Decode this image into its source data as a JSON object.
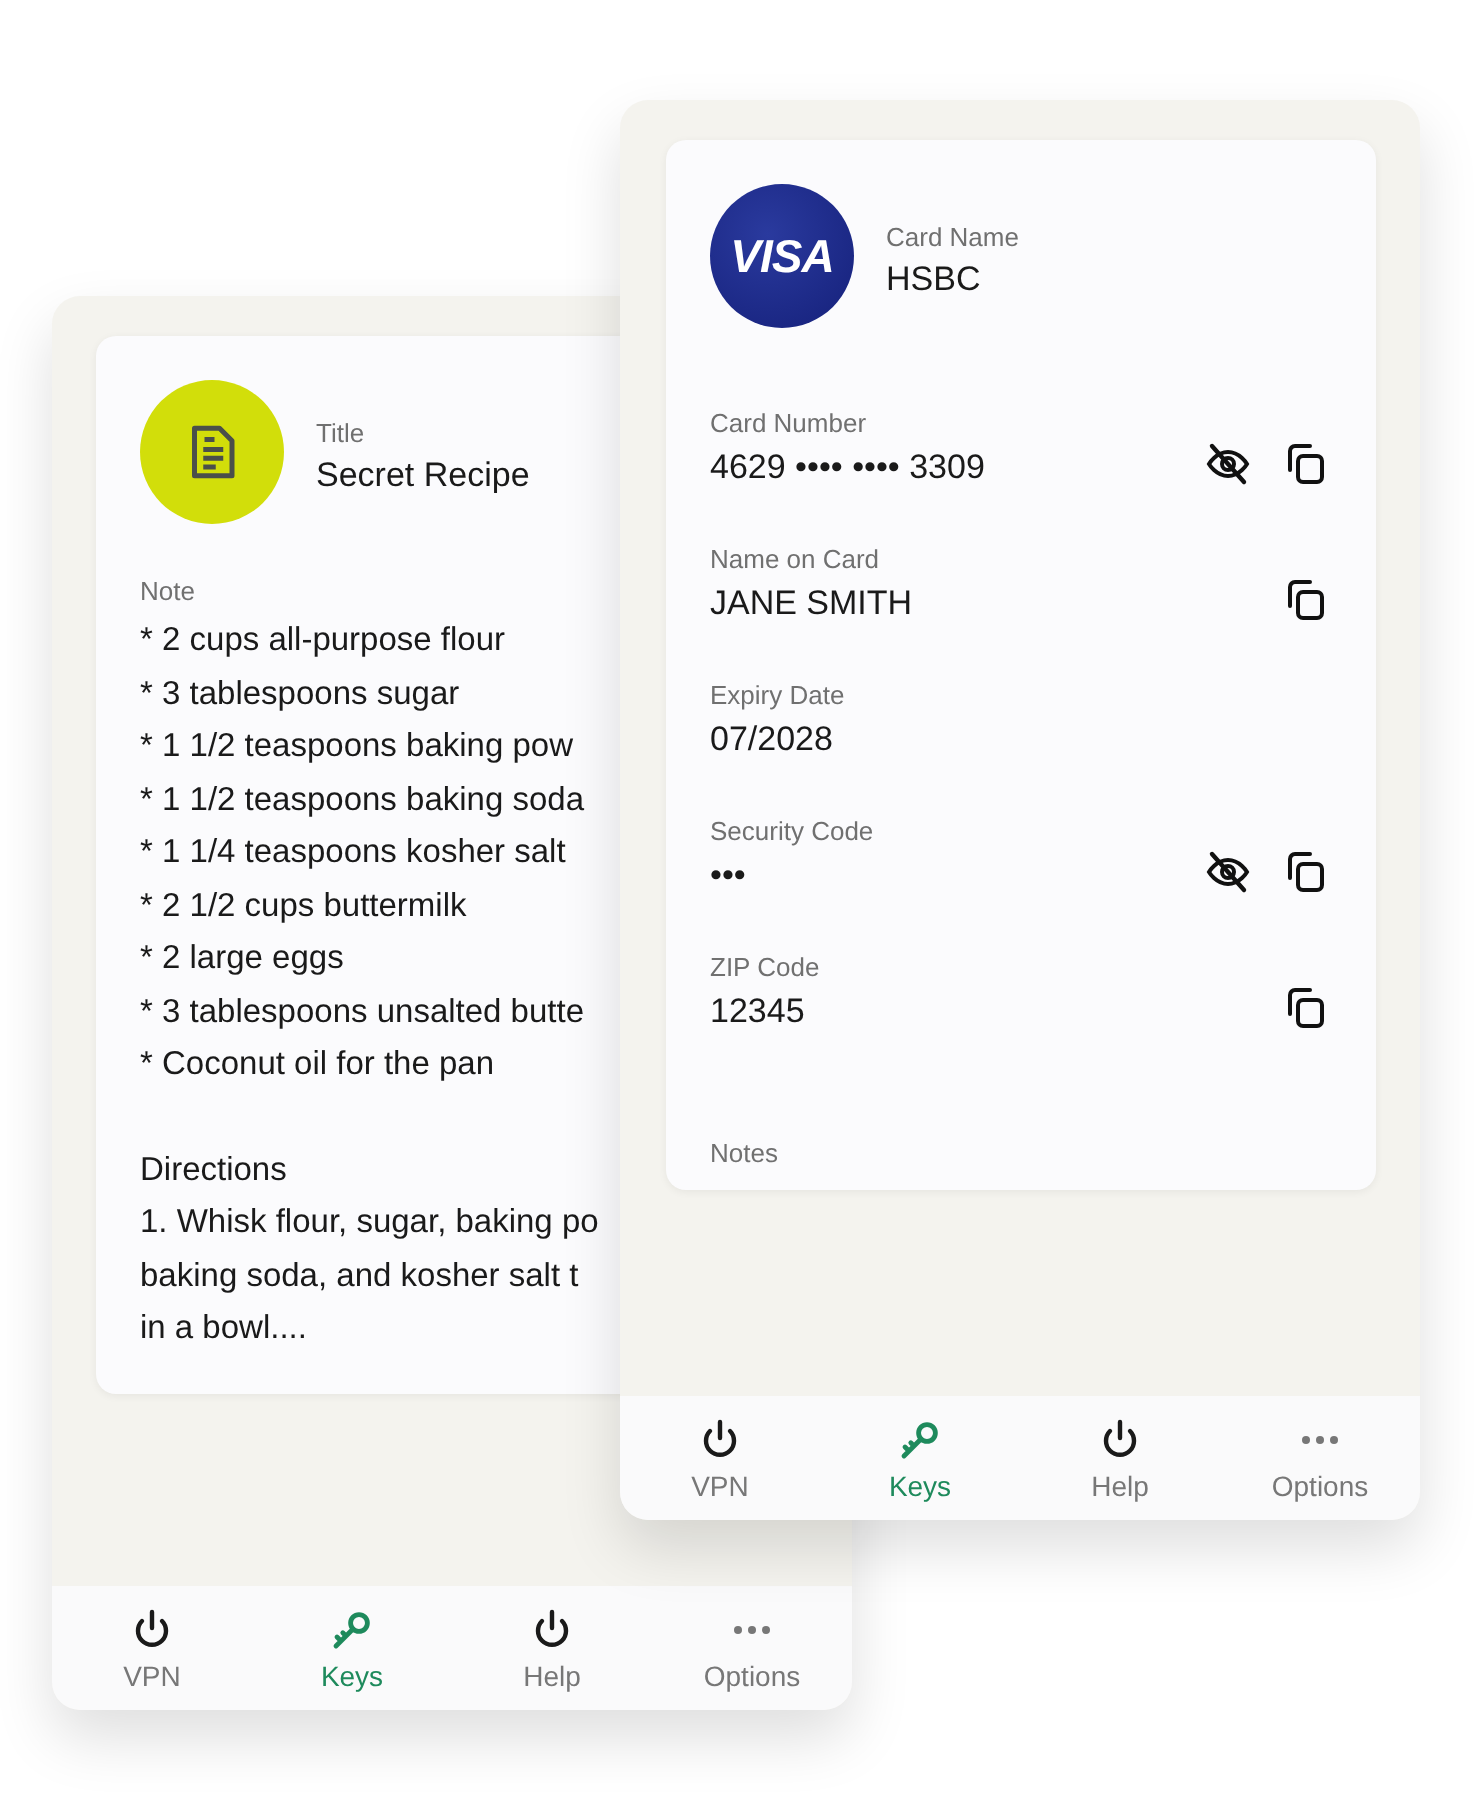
{
  "back_window": {
    "title_label": "Title",
    "title": "Secret Recipe",
    "note_label": "Note",
    "note_paragraphs": [
      [
        "* 2 cups all-purpose flour",
        "* 3 tablespoons sugar",
        "* 1 1/2 teaspoons baking pow",
        "* 1 1/2 teaspoons baking soda",
        "* 1 1/4 teaspoons kosher salt",
        "* 2 1/2 cups buttermilk",
        "* 2 large eggs",
        "* 3 tablespoons unsalted butte",
        "* Coconut oil for the pan"
      ],
      [
        "Directions",
        "1. Whisk flour, sugar, baking po",
        "baking soda, and kosher salt t",
        "in a bowl...."
      ]
    ],
    "nav": [
      {
        "label": "VPN",
        "kind": "power",
        "selected": false
      },
      {
        "label": "Keys",
        "kind": "key",
        "selected": true
      },
      {
        "label": "Help",
        "kind": "power",
        "selected": false
      },
      {
        "label": "Options",
        "kind": "more",
        "selected": false
      }
    ]
  },
  "front_window": {
    "brand": "VISA",
    "card_name_label": "Card Name",
    "card_name": "HSBC",
    "fields": [
      {
        "label": "Card Number",
        "value": "4629 •••• •••• 3309",
        "hide_toggle": true,
        "copy": true
      },
      {
        "label": "Name on Card",
        "value": "JANE SMITH",
        "hide_toggle": false,
        "copy": true
      },
      {
        "label": "Expiry Date",
        "value": "07/2028",
        "hide_toggle": false,
        "copy": false
      },
      {
        "label": "Security Code",
        "value": "•••",
        "hide_toggle": true,
        "copy": true
      },
      {
        "label": "ZIP Code",
        "value": "12345",
        "hide_toggle": false,
        "copy": true
      },
      {
        "label": "Notes",
        "hide_toggle": false,
        "copy": false
      }
    ],
    "nav": [
      {
        "label": "VPN",
        "kind": "power",
        "selected": false
      },
      {
        "label": "Keys",
        "kind": "key",
        "selected": true
      },
      {
        "label": "Help",
        "kind": "power",
        "selected": false
      },
      {
        "label": "Options",
        "kind": "more",
        "selected": false
      }
    ]
  }
}
